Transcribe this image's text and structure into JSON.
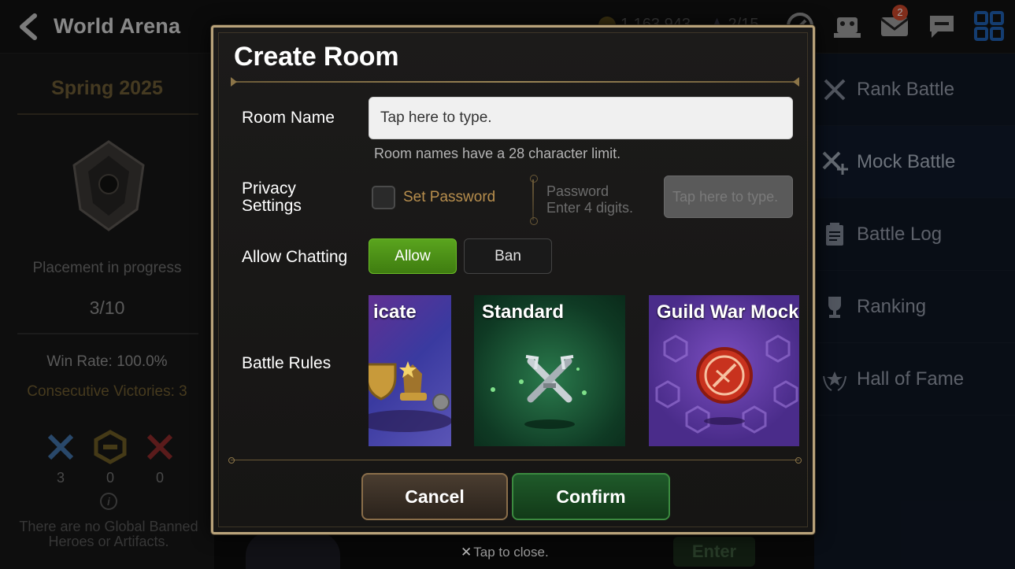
{
  "header": {
    "title": "World Arena",
    "resource_1": "1,163,943",
    "resource_2": "2/15",
    "mail_badge": "2"
  },
  "left_panel": {
    "season": "Spring 2025",
    "placement": "Placement in progress",
    "placement_count": "3/10",
    "win_rate": "Win Rate: 100.0%",
    "consecutive": "Consecutive Victories: 3",
    "stats": [
      {
        "icon": "crossed-swords-blue-icon",
        "value": "3"
      },
      {
        "icon": "draw-shield-icon",
        "value": "0"
      },
      {
        "icon": "crossed-swords-red-icon",
        "value": "0"
      }
    ],
    "banned_note": "There are no Global Banned Heroes or Artifacts."
  },
  "right_menu": {
    "items": [
      {
        "label": "Rank Battle",
        "icon": "crossed-swords-icon"
      },
      {
        "label": "Mock Battle",
        "icon": "swords-plus-icon"
      },
      {
        "label": "Battle Log",
        "icon": "clipboard-icon"
      },
      {
        "label": "Ranking",
        "icon": "trophy-icon"
      },
      {
        "label": "Hall of Fame",
        "icon": "laurel-star-icon"
      }
    ]
  },
  "modal": {
    "title": "Create Room",
    "room_name_label": "Room Name",
    "room_name_placeholder": "Tap here to type.",
    "room_name_hint": "Room names have a 28 character limit.",
    "privacy_label_1": "Privacy",
    "privacy_label_2": "Settings",
    "set_password_label": "Set Password",
    "password_label": "Password",
    "password_hint": "Enter 4 digits.",
    "password_placeholder": "Tap here to type.",
    "chat_label": "Allow Chatting",
    "chat_allow": "Allow",
    "chat_ban": "Ban",
    "rules_label": "Battle Rules",
    "rules": [
      {
        "title": "icate"
      },
      {
        "title": "Standard"
      },
      {
        "title": "Guild War Mock"
      }
    ],
    "cancel": "Cancel",
    "confirm": "Confirm"
  },
  "footer": {
    "tap_close": "Tap to close.",
    "enter": "Enter"
  },
  "colors": {
    "allow_green": "#4a8f16",
    "gold_accent": "#b8a27a",
    "password_orange": "#b78e4d"
  }
}
